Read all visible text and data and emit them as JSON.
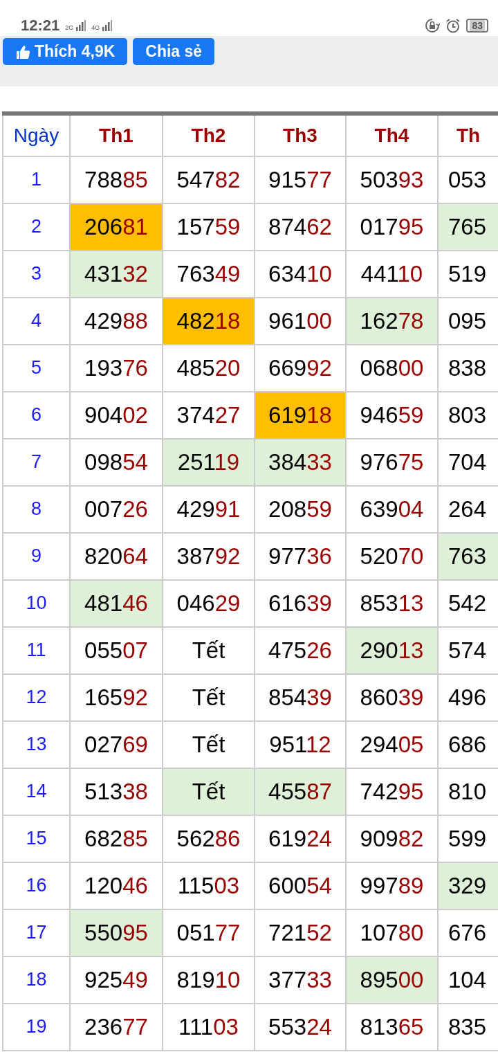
{
  "status_bar": {
    "time": "12:21",
    "network_labels": [
      "2G",
      "4G"
    ],
    "battery": "83"
  },
  "share_bar": {
    "like_button": "Thích 4,9K",
    "share_button": "Chia sẻ"
  },
  "table": {
    "day_header": "Ngày",
    "columns": [
      "Th1",
      "Th2",
      "Th3",
      "Th4",
      "Th"
    ],
    "rows": [
      {
        "day": "1",
        "cells": [
          {
            "kind": "number",
            "text": "78885"
          },
          {
            "kind": "number",
            "text": "54782"
          },
          {
            "kind": "number",
            "text": "91577"
          },
          {
            "kind": "number",
            "text": "50393"
          },
          {
            "kind": "number",
            "text": "053"
          }
        ]
      },
      {
        "day": "2",
        "cells": [
          {
            "kind": "number",
            "text": "20681",
            "color": "#ffbf00"
          },
          {
            "kind": "number",
            "text": "15759"
          },
          {
            "kind": "number",
            "text": "87462"
          },
          {
            "kind": "number",
            "text": "01795"
          },
          {
            "kind": "number",
            "text": "765",
            "color": "#dff0d8"
          }
        ]
      },
      {
        "day": "3",
        "cells": [
          {
            "kind": "number",
            "text": "43132",
            "color": "#dff0d8"
          },
          {
            "kind": "number",
            "text": "76349"
          },
          {
            "kind": "number",
            "text": "63410"
          },
          {
            "kind": "number",
            "text": "44110"
          },
          {
            "kind": "number",
            "text": "519"
          }
        ]
      },
      {
        "day": "4",
        "cells": [
          {
            "kind": "number",
            "text": "42988"
          },
          {
            "kind": "number",
            "text": "48218",
            "color": "#ffbf00"
          },
          {
            "kind": "number",
            "text": "96100"
          },
          {
            "kind": "number",
            "text": "16278",
            "color": "#dff0d8"
          },
          {
            "kind": "number",
            "text": "095"
          }
        ]
      },
      {
        "day": "5",
        "cells": [
          {
            "kind": "number",
            "text": "19376"
          },
          {
            "kind": "number",
            "text": "48520"
          },
          {
            "kind": "number",
            "text": "66992"
          },
          {
            "kind": "number",
            "text": "06800"
          },
          {
            "kind": "number",
            "text": "838"
          }
        ]
      },
      {
        "day": "6",
        "cells": [
          {
            "kind": "number",
            "text": "90402"
          },
          {
            "kind": "number",
            "text": "37427"
          },
          {
            "kind": "number",
            "text": "61918",
            "color": "#ffbf00"
          },
          {
            "kind": "number",
            "text": "94659"
          },
          {
            "kind": "number",
            "text": "803"
          }
        ]
      },
      {
        "day": "7",
        "cells": [
          {
            "kind": "number",
            "text": "09854"
          },
          {
            "kind": "number",
            "text": "25119",
            "color": "#dff0d8"
          },
          {
            "kind": "number",
            "text": "38433",
            "color": "#dff0d8"
          },
          {
            "kind": "number",
            "text": "97675"
          },
          {
            "kind": "number",
            "text": "704"
          }
        ]
      },
      {
        "day": "8",
        "cells": [
          {
            "kind": "number",
            "text": "00726"
          },
          {
            "kind": "number",
            "text": "42991"
          },
          {
            "kind": "number",
            "text": "20859"
          },
          {
            "kind": "number",
            "text": "63904"
          },
          {
            "kind": "number",
            "text": "264"
          }
        ]
      },
      {
        "day": "9",
        "cells": [
          {
            "kind": "number",
            "text": "82064"
          },
          {
            "kind": "number",
            "text": "38792"
          },
          {
            "kind": "number",
            "text": "97736"
          },
          {
            "kind": "number",
            "text": "52070"
          },
          {
            "kind": "number",
            "text": "763",
            "color": "#dff0d8"
          }
        ]
      },
      {
        "day": "10",
        "cells": [
          {
            "kind": "number",
            "text": "48146",
            "color": "#dff0d8"
          },
          {
            "kind": "number",
            "text": "04629"
          },
          {
            "kind": "number",
            "text": "61639"
          },
          {
            "kind": "number",
            "text": "85313"
          },
          {
            "kind": "number",
            "text": "542"
          }
        ]
      },
      {
        "day": "11",
        "cells": [
          {
            "kind": "number",
            "text": "05507"
          },
          {
            "kind": "word",
            "text": "Tết"
          },
          {
            "kind": "number",
            "text": "47526"
          },
          {
            "kind": "number",
            "text": "29013",
            "color": "#dff0d8"
          },
          {
            "kind": "number",
            "text": "574"
          }
        ]
      },
      {
        "day": "12",
        "cells": [
          {
            "kind": "number",
            "text": "16592"
          },
          {
            "kind": "word",
            "text": "Tết"
          },
          {
            "kind": "number",
            "text": "85439"
          },
          {
            "kind": "number",
            "text": "86039"
          },
          {
            "kind": "number",
            "text": "496"
          }
        ]
      },
      {
        "day": "13",
        "cells": [
          {
            "kind": "number",
            "text": "02769"
          },
          {
            "kind": "word",
            "text": "Tết"
          },
          {
            "kind": "number",
            "text": "95112"
          },
          {
            "kind": "number",
            "text": "29405"
          },
          {
            "kind": "number",
            "text": "686"
          }
        ]
      },
      {
        "day": "14",
        "cells": [
          {
            "kind": "number",
            "text": "51338"
          },
          {
            "kind": "word",
            "text": "Tết",
            "color": "#dff0d8"
          },
          {
            "kind": "number",
            "text": "45587",
            "color": "#dff0d8"
          },
          {
            "kind": "number",
            "text": "74295"
          },
          {
            "kind": "number",
            "text": "810"
          }
        ]
      },
      {
        "day": "15",
        "cells": [
          {
            "kind": "number",
            "text": "68285"
          },
          {
            "kind": "number",
            "text": "56286"
          },
          {
            "kind": "number",
            "text": "61924"
          },
          {
            "kind": "number",
            "text": "90982"
          },
          {
            "kind": "number",
            "text": "599"
          }
        ]
      },
      {
        "day": "16",
        "cells": [
          {
            "kind": "number",
            "text": "12046"
          },
          {
            "kind": "number",
            "text": "11503"
          },
          {
            "kind": "number",
            "text": "60054"
          },
          {
            "kind": "number",
            "text": "99789"
          },
          {
            "kind": "number",
            "text": "329",
            "color": "#dff0d8"
          }
        ]
      },
      {
        "day": "17",
        "cells": [
          {
            "kind": "number",
            "text": "55095",
            "color": "#dff0d8"
          },
          {
            "kind": "number",
            "text": "05177"
          },
          {
            "kind": "number",
            "text": "72152"
          },
          {
            "kind": "number",
            "text": "10780"
          },
          {
            "kind": "number",
            "text": "676"
          }
        ]
      },
      {
        "day": "18",
        "cells": [
          {
            "kind": "number",
            "text": "92549"
          },
          {
            "kind": "number",
            "text": "81910"
          },
          {
            "kind": "number",
            "text": "37733"
          },
          {
            "kind": "number",
            "text": "89500",
            "color": "#dff0d8"
          },
          {
            "kind": "number",
            "text": "104"
          }
        ]
      },
      {
        "day": "19",
        "cells": [
          {
            "kind": "number",
            "text": "23677"
          },
          {
            "kind": "number",
            "text": "11103"
          },
          {
            "kind": "number",
            "text": "55324"
          },
          {
            "kind": "number",
            "text": "81365"
          },
          {
            "kind": "number",
            "text": "835"
          }
        ]
      }
    ]
  }
}
